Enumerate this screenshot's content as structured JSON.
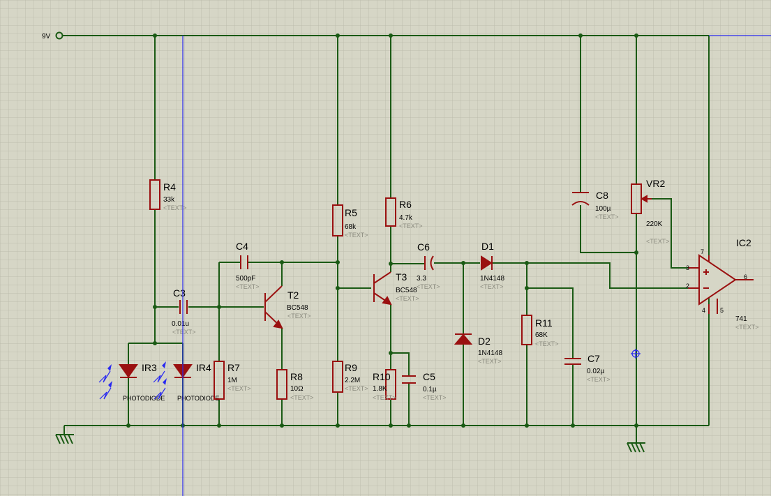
{
  "supply": {
    "label": "9V"
  },
  "placeholder": "<TEXT>",
  "components": {
    "R4": {
      "ref": "R4",
      "value": "33k"
    },
    "R5": {
      "ref": "R5",
      "value": "68k"
    },
    "R6": {
      "ref": "R6",
      "value": "4.7k"
    },
    "R7": {
      "ref": "R7",
      "value": "1M"
    },
    "R8": {
      "ref": "R8",
      "value": "10Ω"
    },
    "R9": {
      "ref": "R9",
      "value": "2.2M"
    },
    "R10": {
      "ref": "R10",
      "value": "1.8K"
    },
    "R11": {
      "ref": "R11",
      "value": "68K"
    },
    "C3": {
      "ref": "C3",
      "value": "0.01u"
    },
    "C4": {
      "ref": "C4",
      "value": "500pF"
    },
    "C5": {
      "ref": "C5",
      "value": "0.1µ"
    },
    "C6": {
      "ref": "C6",
      "value": "3.3"
    },
    "C7": {
      "ref": "C7",
      "value": "0.02µ"
    },
    "C8": {
      "ref": "C8",
      "value": "100µ"
    },
    "T2": {
      "ref": "T2",
      "value": "BC548"
    },
    "T3": {
      "ref": "T3",
      "value": "BC548"
    },
    "D1": {
      "ref": "D1",
      "value": "1N4148"
    },
    "D2": {
      "ref": "D2",
      "value": "1N4148"
    },
    "IR3": {
      "ref": "IR3",
      "value": "PHOTODIODE"
    },
    "IR4": {
      "ref": "IR4",
      "value": "PHOTODIODE"
    },
    "VR2": {
      "ref": "VR2",
      "value": "220K"
    },
    "IC2": {
      "ref": "IC2",
      "value": "741"
    }
  },
  "ic2_pins": {
    "p2": "2",
    "p3": "3",
    "p4": "4",
    "p5": "5",
    "p6": "6",
    "p7": "7"
  },
  "colors": {
    "background": "#d6d6c6",
    "grid": "#bdbdad",
    "wire": "#1a5a14",
    "component": "#9a1010",
    "cursor_line": "#2a2af0",
    "hidden_text": "#8a8a7e"
  }
}
